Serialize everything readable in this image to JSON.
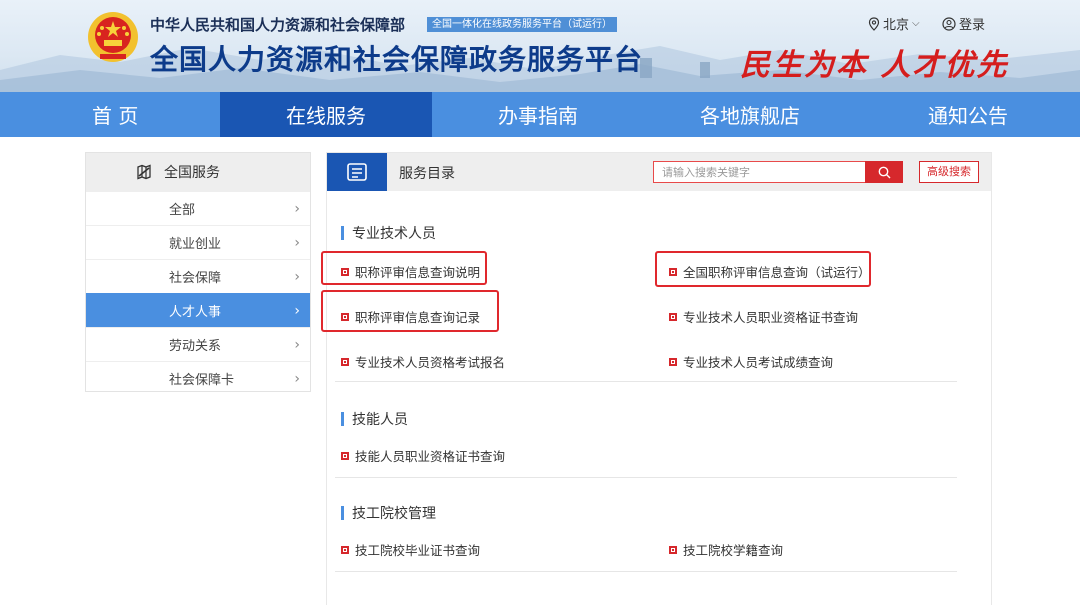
{
  "header": {
    "ministry": "中华人民共和国人力资源和社会保障部",
    "tag": "全国一体化在线政务服务平台（试运行）",
    "platform_title": "全国人力资源和社会保障政务服务平台",
    "slogan": "民生为本 人才优先",
    "region": "北京",
    "login": "登录"
  },
  "nav": {
    "items": [
      "首 页",
      "在线服务",
      "办事指南",
      "各地旗舰店",
      "通知公告"
    ],
    "active": "在线服务"
  },
  "sidebar": {
    "title": "全国服务",
    "items": [
      {
        "label": "全部"
      },
      {
        "label": "就业创业"
      },
      {
        "label": "社会保障"
      },
      {
        "label": "人才人事"
      },
      {
        "label": "劳动关系"
      },
      {
        "label": "社会保障卡"
      }
    ],
    "active": "人才人事"
  },
  "main": {
    "title": "服务目录",
    "search_placeholder": "请输入搜索关键字",
    "advanced_search": "高级搜索",
    "sections": [
      {
        "title": "专业技术人员",
        "links": [
          "职称评审信息查询说明",
          "全国职称评审信息查询（试运行）",
          "职称评审信息查询记录",
          "专业技术人员职业资格证书查询",
          "专业技术人员资格考试报名",
          "专业技术人员考试成绩查询"
        ]
      },
      {
        "title": "技能人员",
        "links": [
          "技能人员职业资格证书查询"
        ]
      },
      {
        "title": "技工院校管理",
        "links": [
          "技工院校毕业证书查询",
          "技工院校学籍查询"
        ]
      }
    ]
  },
  "colors": {
    "nav_blue": "#4a8fe0",
    "nav_active": "#1a56b3",
    "accent_red": "#d6282c",
    "title_blue": "#0d3b8a"
  }
}
